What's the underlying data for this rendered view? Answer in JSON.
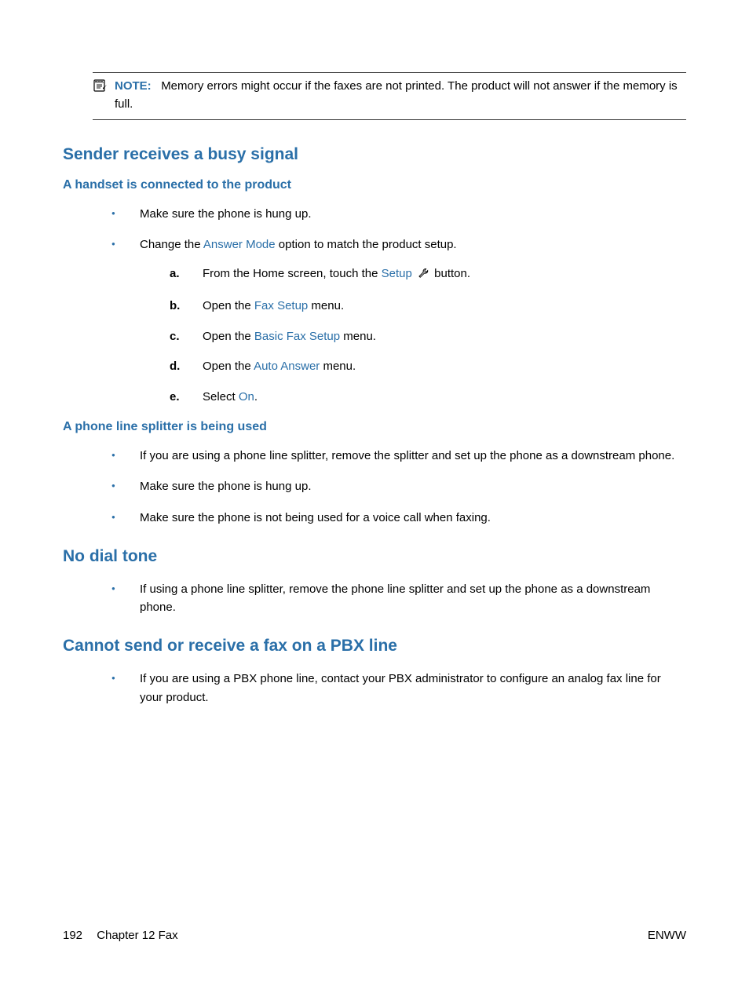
{
  "note": {
    "label": "NOTE:",
    "text": "Memory errors might occur if the faxes are not printed. The product will not answer if the memory is full."
  },
  "section1": {
    "title": "Sender receives a busy signal",
    "sub1": {
      "title": "A handset is connected to the product",
      "bullet1": "Make sure the phone is hung up.",
      "bullet2_pre": "Change the ",
      "bullet2_term": "Answer Mode",
      "bullet2_post": " option to match the product setup.",
      "steps": {
        "a_pre": "From the Home screen, touch the ",
        "a_term": "Setup",
        "a_post": " button.",
        "b_pre": "Open the ",
        "b_term": "Fax Setup",
        "b_post": " menu.",
        "c_pre": "Open the ",
        "c_term": "Basic Fax Setup",
        "c_post": " menu.",
        "d_pre": "Open the ",
        "d_term": "Auto Answer",
        "d_post": " menu.",
        "e_pre": "Select ",
        "e_term": "On",
        "e_post": "."
      }
    },
    "sub2": {
      "title": "A phone line splitter is being used",
      "bullet1": "If you are using a phone line splitter, remove the splitter and set up the phone as a downstream phone.",
      "bullet2": "Make sure the phone is hung up.",
      "bullet3": "Make sure the phone is not being used for a voice call when faxing."
    }
  },
  "section2": {
    "title": "No dial tone",
    "bullet1": "If using a phone line splitter, remove the phone line splitter and set up the phone as a downstream phone."
  },
  "section3": {
    "title": "Cannot send or receive a fax on a PBX line",
    "bullet1": "If you are using a PBX phone line, contact your PBX administrator to configure an analog fax line for your product."
  },
  "footer": {
    "page": "192",
    "chapter": "Chapter 12   Fax",
    "right": "ENWW"
  }
}
